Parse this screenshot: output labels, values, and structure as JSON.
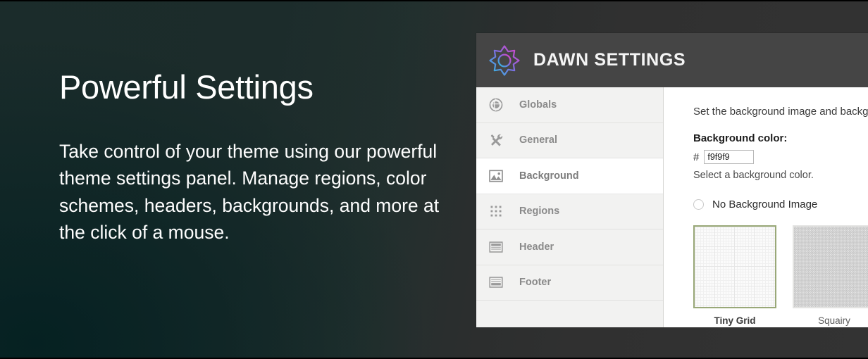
{
  "marketing": {
    "heading": "Powerful Settings",
    "body": "Take control of your theme using our powerful theme settings panel. Manage regions, color schemes, headers, backgrounds, and more at the click of a mouse."
  },
  "panel": {
    "header": {
      "title": "DAWN SETTINGS",
      "logo_icon": "sunburst-logo-icon",
      "background_color": "#454545",
      "logo_gradient_start": "#29c0e0",
      "logo_gradient_end": "#e83ec8"
    },
    "sidebar": {
      "items": [
        {
          "label": "Globals",
          "icon": "globe-icon",
          "active": false
        },
        {
          "label": "General",
          "icon": "tools-icon",
          "active": false
        },
        {
          "label": "Background",
          "icon": "image-icon",
          "active": true
        },
        {
          "label": "Regions",
          "icon": "grid-dots-icon",
          "active": false
        },
        {
          "label": "Header",
          "icon": "header-layout-icon",
          "active": false
        },
        {
          "label": "Footer",
          "icon": "footer-layout-icon",
          "active": false
        }
      ]
    },
    "content": {
      "intro": "Set the background image and backg",
      "background_color_label": "Background color:",
      "hash_symbol": "#",
      "color_value": "f9f9f9",
      "color_placeholder": "f9f9f9",
      "color_help": "Select a background color.",
      "no_background_option": "No Background Image",
      "thumbnails": [
        {
          "caption": "Tiny Grid",
          "pattern": "tiny-grid",
          "selected": true,
          "border_color": "#99a878"
        },
        {
          "caption": "Squairy",
          "pattern": "squairy",
          "selected": false,
          "border_color": "#e3e3e1"
        }
      ]
    }
  }
}
